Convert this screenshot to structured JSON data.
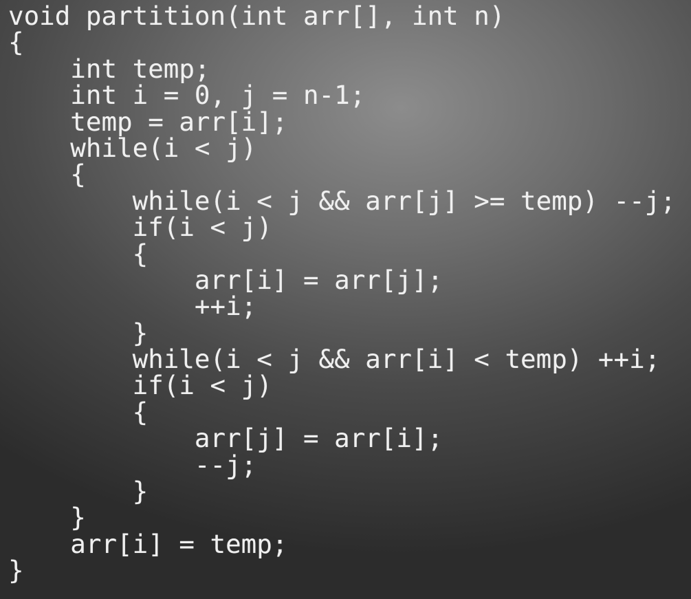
{
  "code": {
    "lines": [
      "void partition(int arr[], int n)",
      "{",
      "    int temp;",
      "    int i = 0, j = n-1;",
      "    temp = arr[i];",
      "    while(i < j)",
      "    {",
      "        while(i < j && arr[j] >= temp) --j;",
      "        if(i < j)",
      "        {",
      "            arr[i] = arr[j];",
      "            ++i;",
      "        }",
      "        while(i < j && arr[i] < temp) ++i;",
      "        if(i < j)",
      "        {",
      "            arr[j] = arr[i];",
      "            --j;",
      "        }",
      "    }",
      "    arr[i] = temp;",
      "}"
    ]
  }
}
